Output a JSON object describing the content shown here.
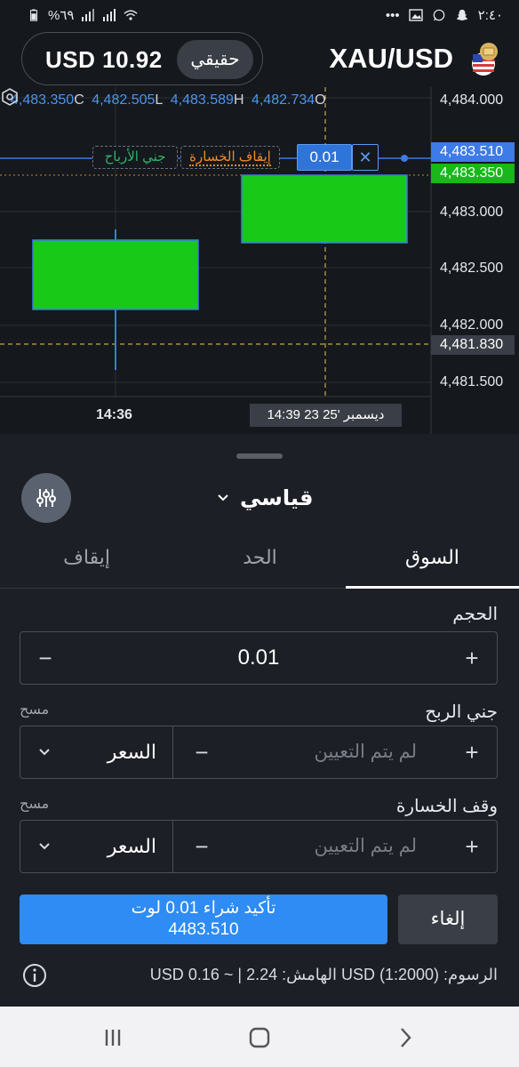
{
  "status_bar": {
    "battery": "%٦٩",
    "time": "٢:٤٠",
    "dots": "•••"
  },
  "header": {
    "balance": "USD 10.92",
    "account_type": "حقيقي",
    "symbol": "XAU/USD"
  },
  "chart": {
    "ohlc": [
      {
        "value": "4,483.350",
        "label": "C"
      },
      {
        "value": "4,482.505",
        "label": "L"
      },
      {
        "value": "4,483.589",
        "label": "H"
      },
      {
        "value": "4,482.734",
        "label": "O"
      }
    ],
    "price_axis": [
      "4,484.000",
      "4,483.000",
      "4,482.500",
      "4,482.000",
      "4,481.500"
    ],
    "ask_tag": "4,483.510",
    "bid_tag": "4,483.350",
    "cross_tag": "4,481.830",
    "take_profit_label": "جني الأرباح",
    "stop_loss_label": "إيقاف الخسارة",
    "volume_tag": "0.01",
    "close_symbol": "✕",
    "time_label": "14:36",
    "crosshair_time": "ديسمبر '25  23 14:39",
    "colors": {
      "bull_candle": "#19c918",
      "ask_line": "#3d7be8",
      "bid_tag": "#18b818",
      "crosshair": "#e6c84a"
    }
  },
  "panel": {
    "mode": "قياسي",
    "tabs": [
      "السوق",
      "الحد",
      "إيقاف"
    ],
    "volume": {
      "label": "الحجم",
      "value": "0.01"
    },
    "take_profit": {
      "label": "جني الربح",
      "clear": "مسح",
      "placeholder": "لم يتم التعيين",
      "mode": "السعر"
    },
    "stop_loss": {
      "label": "وقف الخسارة",
      "clear": "مسح",
      "placeholder": "لم يتم التعيين",
      "mode": "السعر"
    },
    "confirm": {
      "line1": "تأكيد شراء 0.01 لوت",
      "line2": "4483.510"
    },
    "cancel": "إلغاء",
    "fees": "الرسوم: (USD (1:2000 الهامش: 2.24 | ~ 0.16 USD",
    "minus": "−",
    "plus": "+"
  }
}
